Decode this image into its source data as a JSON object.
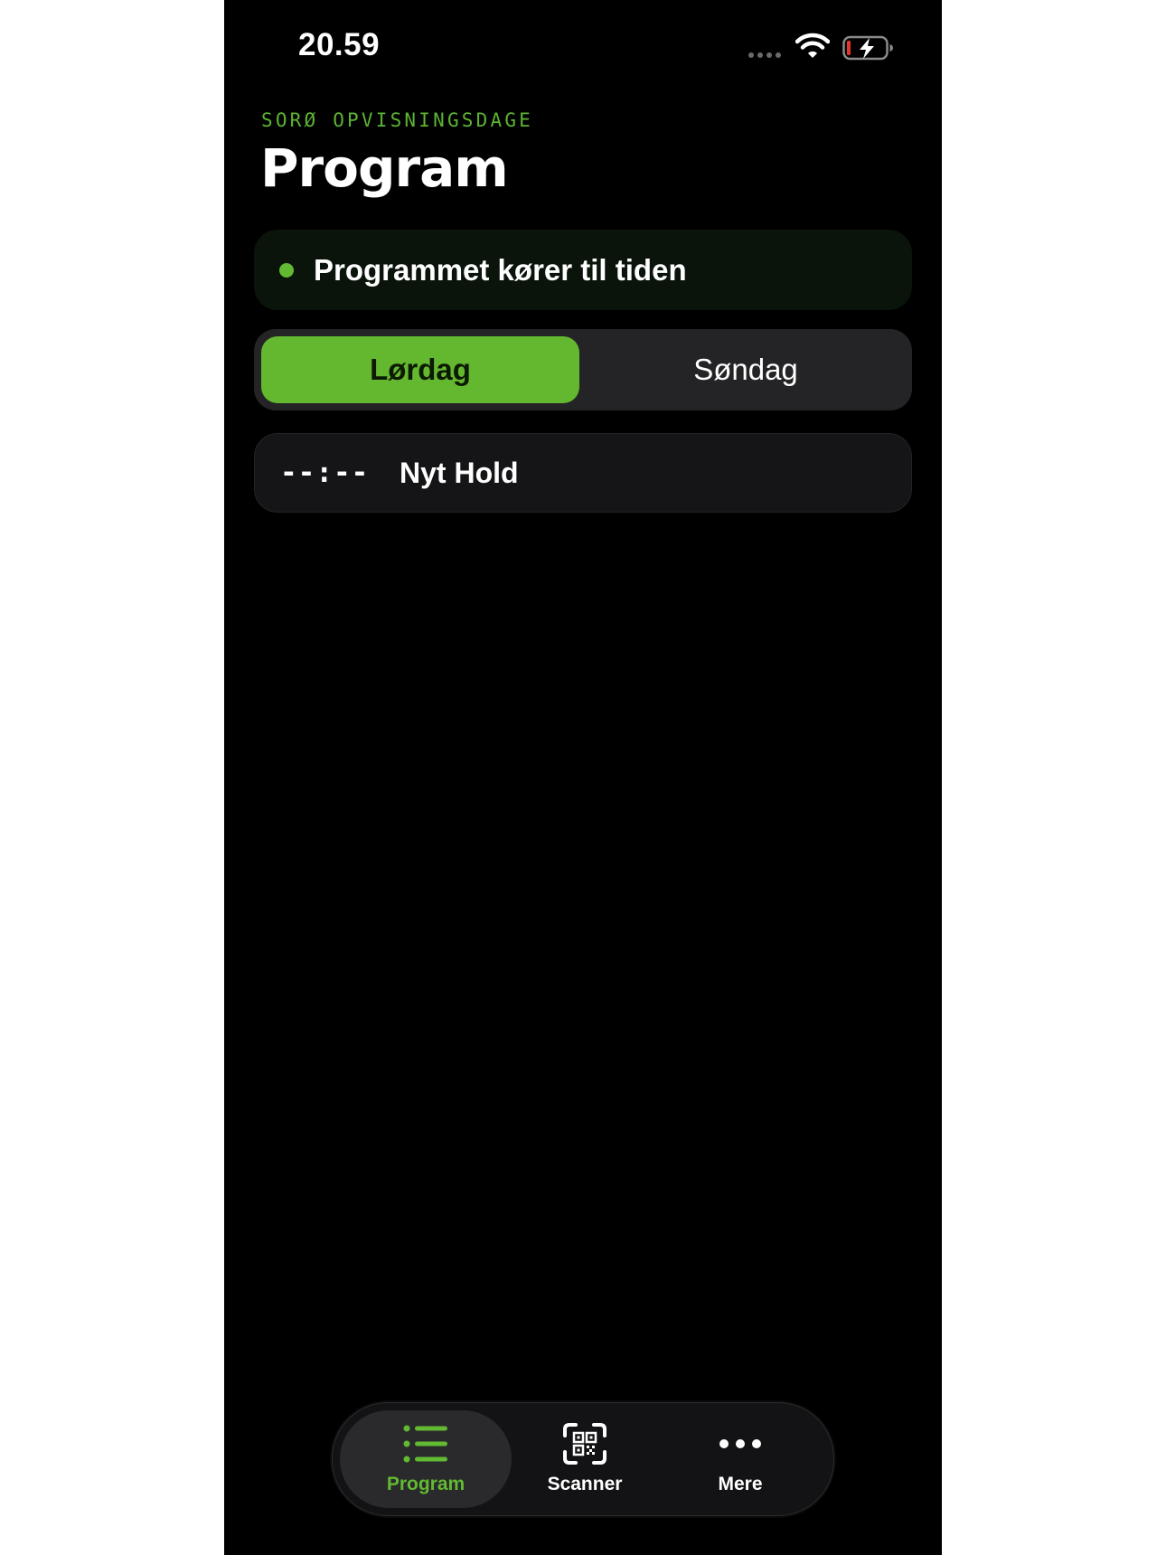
{
  "status_bar": {
    "time": "20.59"
  },
  "header": {
    "eyebrow": "SORØ OPVISNINGSDAGE",
    "title": "Program"
  },
  "banner": {
    "text": "Programmet kører til tiden"
  },
  "day_toggle": {
    "options": [
      "Lørdag",
      "Søndag"
    ],
    "selected": "Lørdag"
  },
  "program_items": [
    {
      "time": "--:--",
      "name": "Nyt Hold"
    }
  ],
  "tab_bar": {
    "tabs": [
      {
        "label": "Program",
        "icon": "list-icon",
        "active": true
      },
      {
        "label": "Scanner",
        "icon": "qr-scan-icon",
        "active": false
      },
      {
        "label": "Mere",
        "icon": "more-icon",
        "active": false
      }
    ]
  },
  "colors": {
    "accent": "#62b932",
    "background": "#000000",
    "card": "#151517",
    "toggle_bg": "#242426"
  }
}
